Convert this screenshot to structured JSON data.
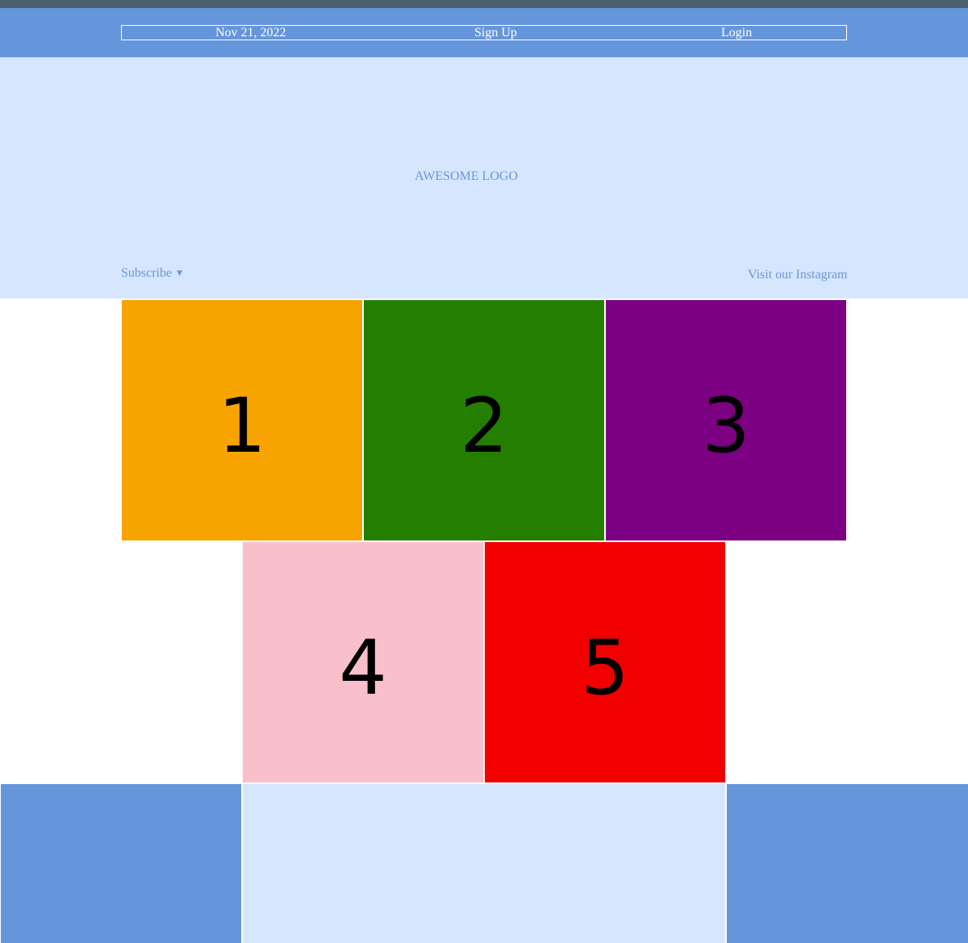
{
  "header": {
    "date": "Nov 21, 2022",
    "signup_label": "Sign Up",
    "login_label": "Login"
  },
  "hero": {
    "logo_text": "AWESOME LOGO",
    "subscribe_label": "Subscribe",
    "subscribe_caret": "▼",
    "instagram_label": "Visit our Instagram"
  },
  "tiles": [
    {
      "label": "1",
      "color": "#f7a400"
    },
    {
      "label": "2",
      "color": "#247f00"
    },
    {
      "label": "3",
      "color": "#7c0082"
    },
    {
      "label": "4",
      "color": "#f9c0cc"
    },
    {
      "label": "5",
      "color": "#f20000"
    }
  ],
  "colors": {
    "top_strip": "#4a5f6d",
    "navbar": "#6596dc",
    "hero_bg": "#d6e6fe",
    "link_text": "#6a96d4"
  }
}
